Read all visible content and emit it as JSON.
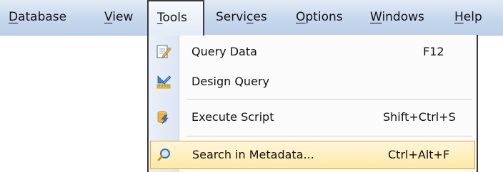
{
  "menubar": {
    "items": [
      {
        "label": "Database",
        "underline_char": "D"
      },
      {
        "label": "View",
        "underline_char": "V"
      },
      {
        "label": "Tools",
        "underline_char": "T"
      },
      {
        "label": "Services",
        "underline_char": "c"
      },
      {
        "label": "Options",
        "underline_char": "O"
      },
      {
        "label": "Windows",
        "underline_char": "W"
      },
      {
        "label": "Help",
        "underline_char": "H"
      }
    ]
  },
  "tools_menu": {
    "items": [
      {
        "label": "Query Data",
        "shortcut": "F12",
        "icon": "query-data-icon"
      },
      {
        "label": "Design Query",
        "shortcut": "",
        "icon": "design-query-icon"
      },
      {
        "label": "Execute Script",
        "shortcut": "Shift+Ctrl+S",
        "icon": "execute-script-icon"
      },
      {
        "label": "Search in Metadata...",
        "shortcut": "Ctrl+Alt+F",
        "icon": "search-metadata-icon"
      }
    ]
  },
  "colors": {
    "menubar_bg": "#c7d7ec",
    "highlight_bg": "#ffe9a6",
    "highlight_border": "#d9a93c"
  }
}
